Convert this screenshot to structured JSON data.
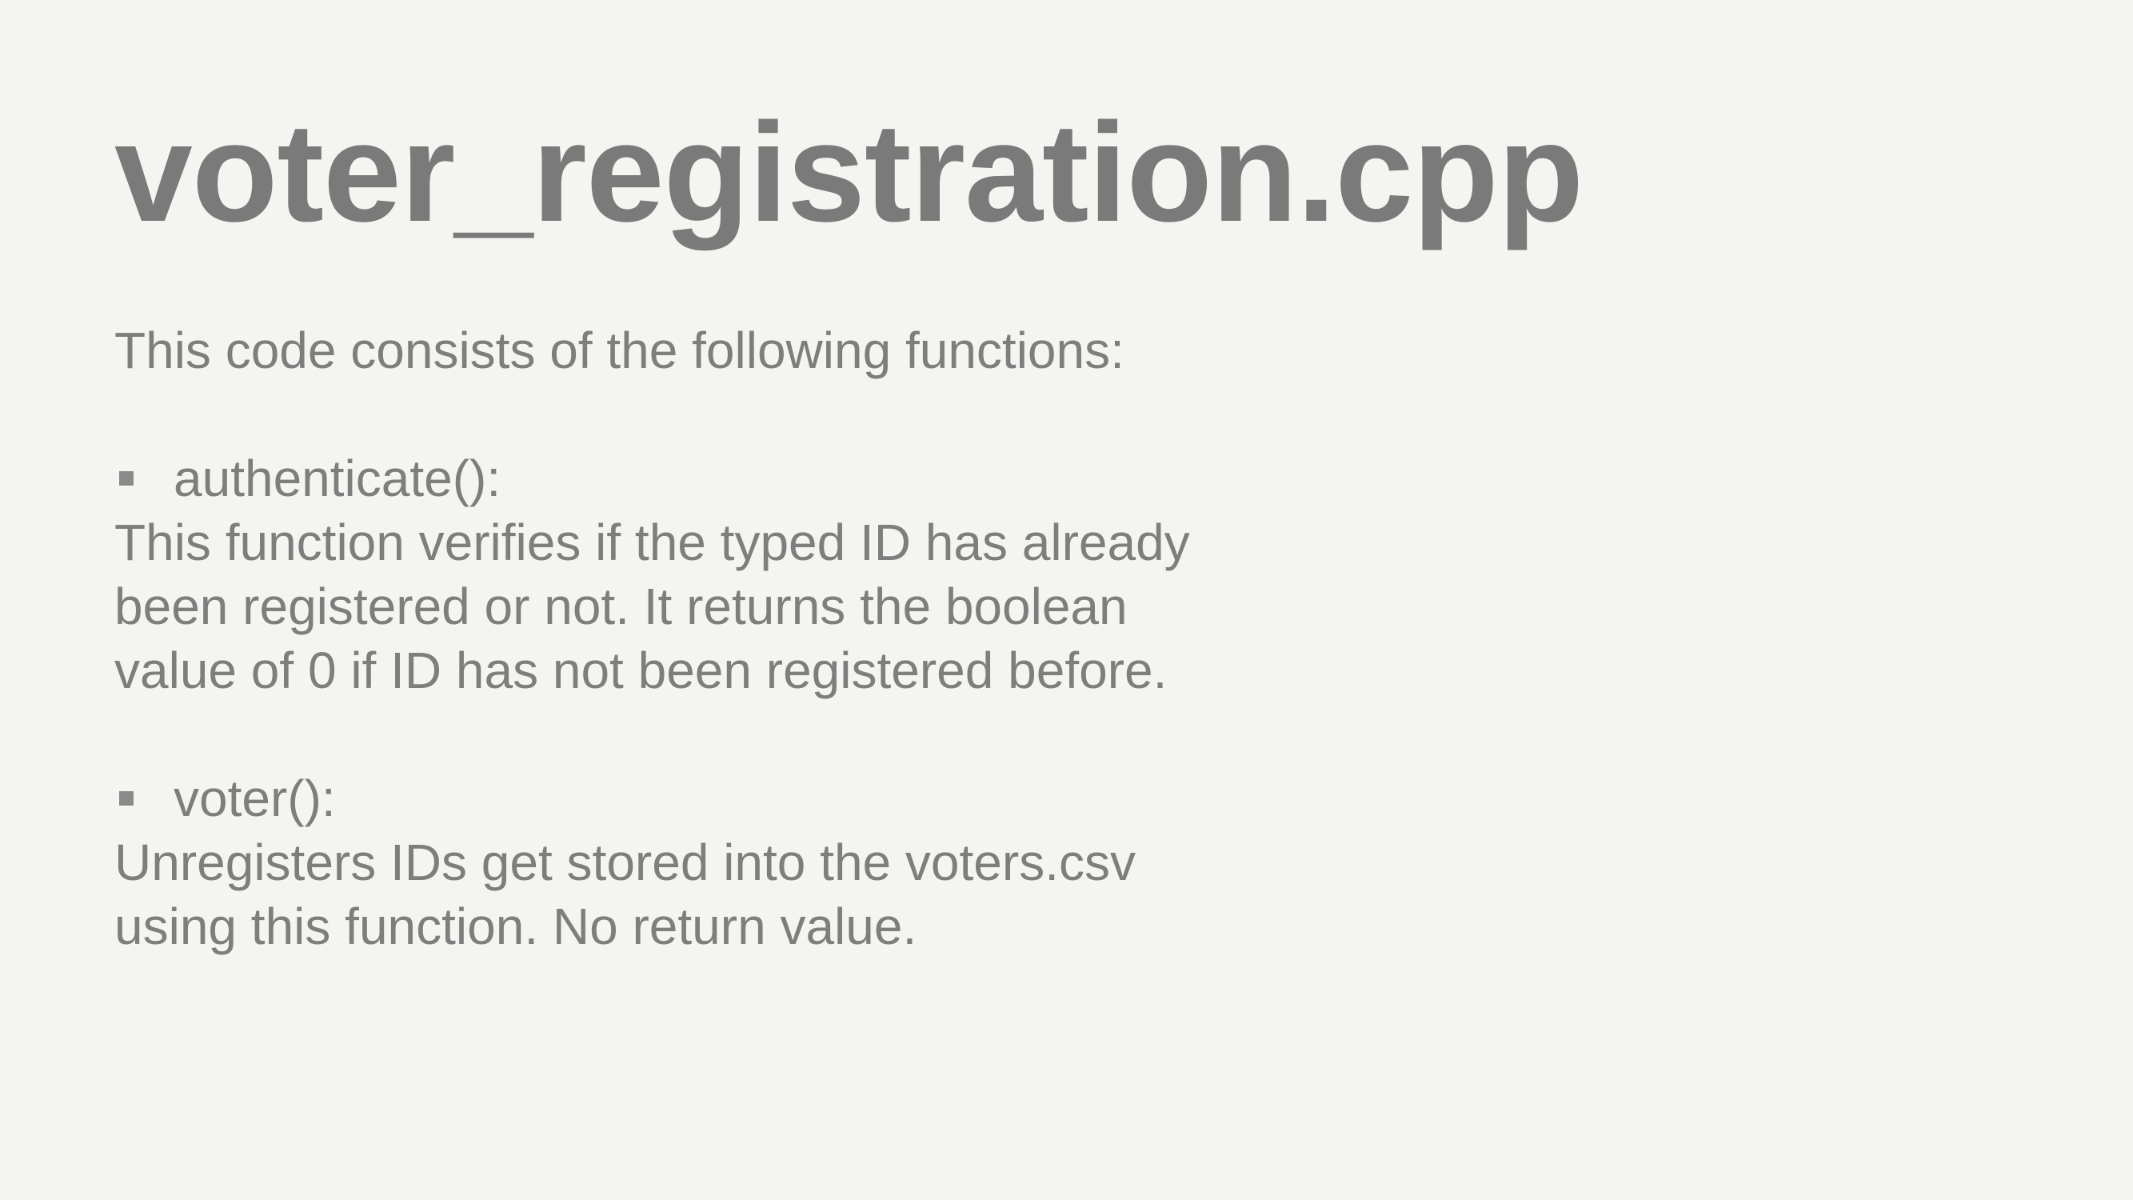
{
  "slide": {
    "title": "voter_registration.cpp",
    "intro": "This code consists of the following functions:",
    "functions": [
      {
        "name": "authenticate():",
        "description": "This function verifies if the typed ID has already\nbeen registered or not. It returns the boolean\nvalue of 0 if ID has not been registered before."
      },
      {
        "name": "voter():",
        "description": "Unregisters IDs get stored into the voters.csv\nusing this function. No return value."
      }
    ]
  },
  "colors": {
    "background": "#f4f4f0",
    "text": "#7b7b7b",
    "bullet": "#8a8a8a"
  },
  "icons": {
    "bullet": "square-bullet-icon"
  }
}
